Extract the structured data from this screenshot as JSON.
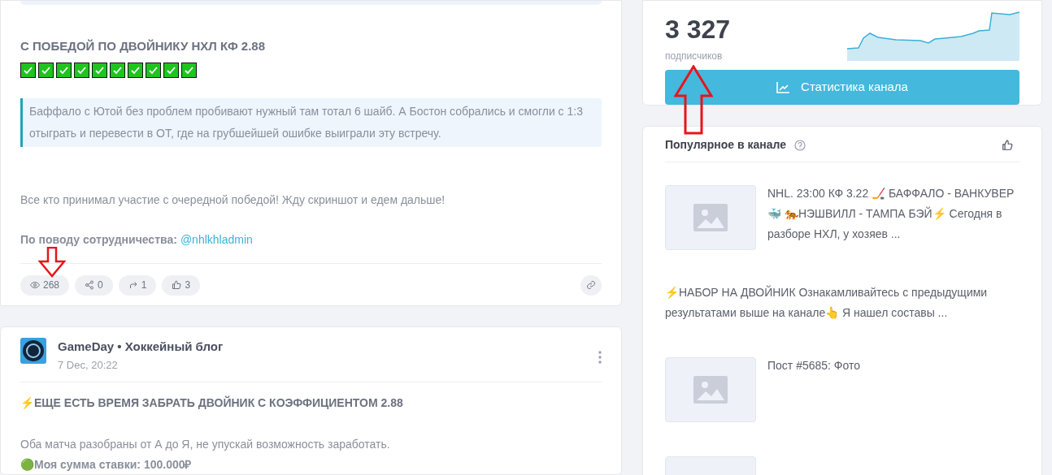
{
  "post": {
    "title": "С ПОБЕДОЙ ПО ДВОЙНИКУ НХЛ КФ 2.88",
    "quote": "Баффало с Ютой без проблем пробивают нужный там тотал 6 шайб. А Бостон собрались и смогли с 1:3 отыграть и перевести в ОТ, где на грубшейшей ошибке выиграли эту встречу.",
    "text": "Все кто принимал участие с очередной победой! Жду скриншот и едем дальше!",
    "contact_label": "По поводу сотрудничества:",
    "contact_link": "@nhlkhladmin",
    "stats": [
      {
        "kind": "views",
        "value": "268"
      },
      {
        "kind": "shares",
        "value": "0"
      },
      {
        "kind": "forwards",
        "value": "1"
      },
      {
        "kind": "likes",
        "value": "3"
      }
    ]
  },
  "post2": {
    "author": "GameDay • Хоккейный блог",
    "date": "7 Dec, 20:22",
    "title": "⚡ЕЩЕ ЕСТЬ ВРЕМЯ ЗАБРАТЬ ДВОЙНИК С КОЭФФИЦИЕНТОМ 2.88",
    "text": "Оба матча разобраны от А до Я, не упускай возможность заработать.",
    "stake": "🟢**Моя сумма ставки: 100.000₽**"
  },
  "subscribers": {
    "count": "3 327",
    "label": "подписчиков",
    "button": "Статистика канала"
  },
  "popular": {
    "title": "Популярное в канале",
    "items": [
      {
        "kind": "image-post",
        "text": "NHL. 23:00 КФ 3.22 🏒 БАФФАЛО - ВАНКУВЕР🐳 🐅НЭШВИЛЛ - ТАМПА БЭЙ⚡ Сегодня в разборе НХЛ, у хозяев ..."
      },
      {
        "kind": "text-post",
        "text": "⚡НАБОР НА ДВОЙНИК Ознакамливайтесь с предыдущими результатами выше на канале👆 Я нашел составы ..."
      },
      {
        "kind": "image-post",
        "text": "Пост #5685: Фото"
      },
      {
        "kind": "cut-off-post"
      }
    ]
  }
}
